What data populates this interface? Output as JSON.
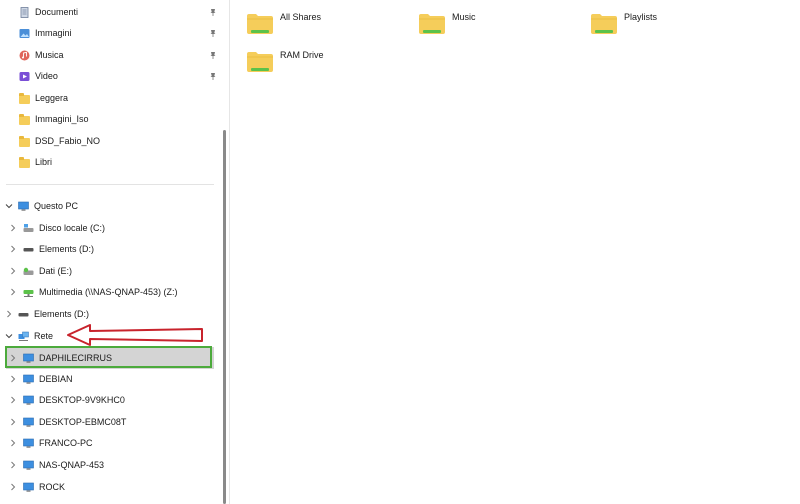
{
  "nav": {
    "quick_access": [
      {
        "label": "Documenti",
        "icon": "document-icon",
        "pinned": true
      },
      {
        "label": "Immagini",
        "icon": "pictures-icon",
        "pinned": true
      },
      {
        "label": "Musica",
        "icon": "music-icon",
        "pinned": true
      },
      {
        "label": "Video",
        "icon": "video-icon",
        "pinned": true
      },
      {
        "label": "Leggera",
        "icon": "folder-icon",
        "pinned": false
      },
      {
        "label": "Immagini_Iso",
        "icon": "folder-icon",
        "pinned": false
      },
      {
        "label": "DSD_Fabio_NO",
        "icon": "folder-icon",
        "pinned": false
      },
      {
        "label": "Libri",
        "icon": "folder-icon",
        "pinned": false
      }
    ],
    "this_pc": {
      "label": "Questo PC",
      "icon": "computer-icon",
      "expanded": true
    },
    "drives": [
      {
        "label": "Disco locale (C:)",
        "icon": "local-disk-icon"
      },
      {
        "label": "Elements (D:)",
        "icon": "usb-drive-icon"
      },
      {
        "label": "Dati (E:)",
        "icon": "drive-icon"
      },
      {
        "label": "Multimedia (\\\\NAS-QNAP-453) (Z:)",
        "icon": "network-drive-icon"
      }
    ],
    "elements_root": {
      "label": "Elements (D:)",
      "icon": "usb-drive-icon"
    },
    "network": {
      "label": "Rete",
      "icon": "network-icon",
      "expanded": true
    },
    "network_items": [
      {
        "label": "DAPHILECIRRUS",
        "selected": true
      },
      {
        "label": "DEBIAN",
        "selected": false
      },
      {
        "label": "DESKTOP-9V9KHC0",
        "selected": false
      },
      {
        "label": "DESKTOP-EBMC08T",
        "selected": false
      },
      {
        "label": "FRANCO-PC",
        "selected": false
      },
      {
        "label": "NAS-QNAP-453",
        "selected": false
      },
      {
        "label": "ROCK",
        "selected": false
      }
    ]
  },
  "content": {
    "items": [
      {
        "label": "All Shares"
      },
      {
        "label": "Music"
      },
      {
        "label": "Playlists"
      },
      {
        "label": "RAM Drive"
      }
    ]
  },
  "colors": {
    "folder": "#f5cd5a",
    "folder_tab": "#e9b83c",
    "share_green": "#5cc24a",
    "selection": "#d4d4d4",
    "annotation_arrow": "#c8232c",
    "annotation_box": "#4caa3c"
  }
}
